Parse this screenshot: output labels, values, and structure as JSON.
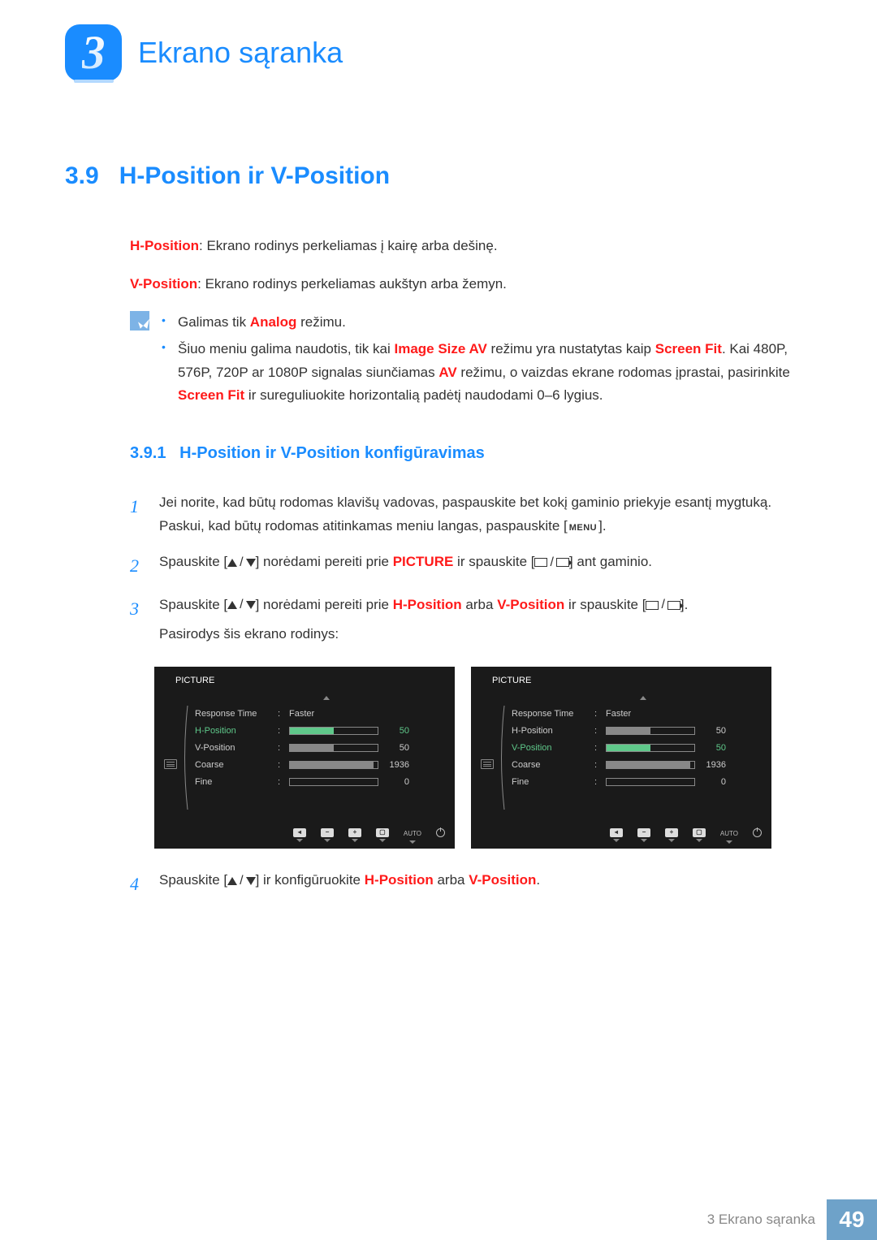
{
  "chapter": {
    "number": "3",
    "title": "Ekrano sąranka"
  },
  "section": {
    "number": "3.9",
    "title": "H-Position ir V-Position"
  },
  "intro": {
    "hpos_label": "H-Position",
    "hpos_text": ": Ekrano rodinys perkeliamas į kairę arba dešinę.",
    "vpos_label": "V-Position",
    "vpos_text": ": Ekrano rodinys perkeliamas aukštyn arba žemyn."
  },
  "notes": {
    "n1a": "Galimas tik ",
    "n1b": "Analog",
    "n1c": " režimu.",
    "n2a": "Šiuo meniu galima naudotis, tik kai ",
    "n2b": "Image Size AV",
    "n2c": " režimu yra nustatytas kaip ",
    "n2d": "Screen Fit",
    "n2e": ". Kai 480P, 576P, 720P ar 1080P signalas siunčiamas ",
    "n2f": "AV",
    "n2g": " režimu, o vaizdas ekrane rodomas įprastai, pasirinkite ",
    "n2h": "Screen Fit",
    "n2i": " ir sureguliuokite horizontalią padėtį naudodami 0–6 lygius."
  },
  "subsection": {
    "number": "3.9.1",
    "title": "H-Position ir V-Position konfigūravimas"
  },
  "steps": {
    "s1": "Jei norite, kad būtų rodomas klavišų vadovas, paspauskite bet kokį gaminio priekyje esantį mygtuką. Paskui, kad būtų rodomas atitinkamas meniu langas, paspauskite [",
    "s1b": "].",
    "s2a": "Spauskite [",
    "s2b": "] norėdami pereiti prie ",
    "s2c": "PICTURE",
    "s2d": " ir spauskite [",
    "s2e": "] ant gaminio.",
    "s3a": "Spauskite [",
    "s3b": "] norėdami pereiti prie ",
    "s3c": "H-Position",
    "s3d": " arba ",
    "s3e": "V-Position",
    "s3f": " ir spauskite [",
    "s3g": "].",
    "s3h": "Pasirodys šis ekrano rodinys:",
    "s4a": "Spauskite [",
    "s4b": "] ir konfigūruokite ",
    "s4c": "H-Position",
    "s4d": " arba ",
    "s4e": "V-Position",
    "s4f": ".",
    "menu": "MENU"
  },
  "osd": {
    "title": "PICTURE",
    "items": [
      {
        "label": "Response Time",
        "value": "Faster"
      },
      {
        "label": "H-Position",
        "bar": 50,
        "num": "50"
      },
      {
        "label": "V-Position",
        "bar": 50,
        "num": "50"
      },
      {
        "label": "Coarse",
        "bar": 95,
        "num": "1936"
      },
      {
        "label": "Fine",
        "bar": 0,
        "num": "0"
      }
    ],
    "auto": "AUTO",
    "highlight_left": 1,
    "highlight_right": 2
  },
  "footer": {
    "text": "3 Ekrano sąranka",
    "page": "49"
  }
}
